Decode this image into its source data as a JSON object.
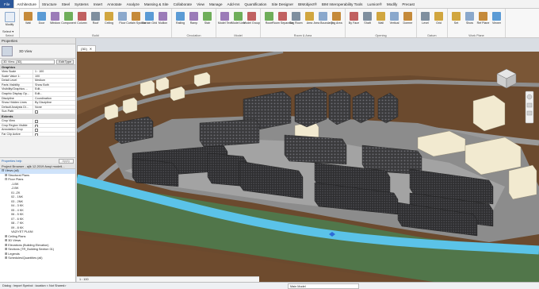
{
  "ribbon_tabs": [
    "File",
    "Architecture",
    "Structure",
    "Steel",
    "Systems",
    "Insert",
    "Annotate",
    "Analyze",
    "Massing & Site",
    "Collaborate",
    "View",
    "Manage",
    "Add-Ins",
    "Quantification",
    "Site Designer",
    "BIMobject®",
    "BIM Interoperability Tools",
    "Lumion®",
    "Modify",
    "Precast"
  ],
  "active_tab": "Architecture",
  "ribbon_groups": [
    {
      "title": "Select",
      "buttons": [
        "Modify"
      ]
    },
    {
      "title": "Build",
      "buttons": [
        "Wall",
        "Door",
        "Window",
        "Component",
        "Column",
        "Roof",
        "Ceiling",
        "Floor",
        "Curtain System",
        "Curtain Grid",
        "Mullion"
      ]
    },
    {
      "title": "Circulation",
      "buttons": [
        "Railing",
        "Ramp",
        "Stair"
      ]
    },
    {
      "title": "Model",
      "buttons": [
        "Model Text",
        "Model Line",
        "Model Group"
      ]
    },
    {
      "title": "Room & Area",
      "buttons": [
        "Room",
        "Room Separator",
        "Tag Room",
        "Area",
        "Area Boundary",
        "Tag Area"
      ]
    },
    {
      "title": "Opening",
      "buttons": [
        "By Face",
        "Shaft",
        "Wall",
        "Vertical",
        "Dormer"
      ]
    },
    {
      "title": "Datum",
      "buttons": [
        "Level",
        "Grid"
      ]
    },
    {
      "title": "Work Plane",
      "buttons": [
        "Set",
        "Show",
        "Ref Plane",
        "Viewer"
      ]
    }
  ],
  "select_label": "Select ▾",
  "properties": {
    "title": "Properties",
    "type_name": "3D View",
    "filter_value": "3D View: {3D}",
    "edit_type": "Edit Type",
    "sections": [
      {
        "name": "Graphics",
        "rows": [
          {
            "k": "View Scale",
            "v": "1 : 100"
          },
          {
            "k": "Scale Value 1:",
            "v": "100"
          },
          {
            "k": "Detail Level",
            "v": "Medium"
          },
          {
            "k": "Parts Visibility",
            "v": "Show Both"
          },
          {
            "k": "Visibility/Graphics ...",
            "v": "Edit..."
          },
          {
            "k": "Graphic Display Op...",
            "v": "Edit..."
          },
          {
            "k": "Discipline",
            "v": "Coordination"
          },
          {
            "k": "Show Hidden Lines",
            "v": "By Discipline"
          },
          {
            "k": "Default Analysis Di...",
            "v": "None"
          },
          {
            "k": "Sun Path",
            "v": ""
          }
        ]
      },
      {
        "name": "Extents",
        "rows": [
          {
            "k": "Crop View",
            "v": ""
          },
          {
            "k": "Crop Region Visible",
            "v": ""
          },
          {
            "k": "Annotation Crop",
            "v": ""
          },
          {
            "k": "Far Clip Active",
            "v": ""
          }
        ]
      }
    ],
    "help_link": "Properties help",
    "apply": "Apply"
  },
  "browser": {
    "title": "Project Browser - ajlk 12.2019 Araçi modeli...",
    "items": [
      {
        "label": "⊟ Views (all)",
        "indent": 0
      },
      {
        "label": "⊞ Structural Plans",
        "indent": 1
      },
      {
        "label": "⊟ Floor Plans",
        "indent": 1
      },
      {
        "label": "-1.BK",
        "indent": 3
      },
      {
        "label": "-2.BK",
        "indent": 3
      },
      {
        "label": "01 -ZK",
        "indent": 3
      },
      {
        "label": "02 - 1NK",
        "indent": 3
      },
      {
        "label": "03 - 2NK",
        "indent": 3
      },
      {
        "label": "04 - 3 KK",
        "indent": 3
      },
      {
        "label": "05 - 4 KK",
        "indent": 3
      },
      {
        "label": "06 - 5 KK",
        "indent": 3
      },
      {
        "label": "07 - 6 KK",
        "indent": 3
      },
      {
        "label": "08 - 7 KK",
        "indent": 3
      },
      {
        "label": "09 - 8 KK",
        "indent": 3
      },
      {
        "label": "VAZIYET PLANI",
        "indent": 3
      },
      {
        "label": "⊞ Ceiling Plans",
        "indent": 1
      },
      {
        "label": "⊞ 3D Views",
        "indent": 1
      },
      {
        "label": "⊞ Elevations (Building Elevation)",
        "indent": 1
      },
      {
        "label": "⊞ Sections (TR_Building Section 01)",
        "indent": 1
      },
      {
        "label": "⊞ Legends",
        "indent": 1
      },
      {
        "label": "⊞ Schedules/Quantities (all)",
        "indent": 1
      }
    ],
    "selected_index": 0
  },
  "view_tab": "{3D}",
  "view_bar": "1 : 100",
  "status": {
    "left": "Dialog : Import Symbol : location < Not Shared>",
    "model": "Main Model"
  },
  "colors": {
    "terrain": "#6b4a2e",
    "road": "#8e8e8e",
    "river": "#5bc3e8",
    "grass": "#51764a",
    "building_dark": "#3c3c3e",
    "building_light": "#f2ead0"
  }
}
